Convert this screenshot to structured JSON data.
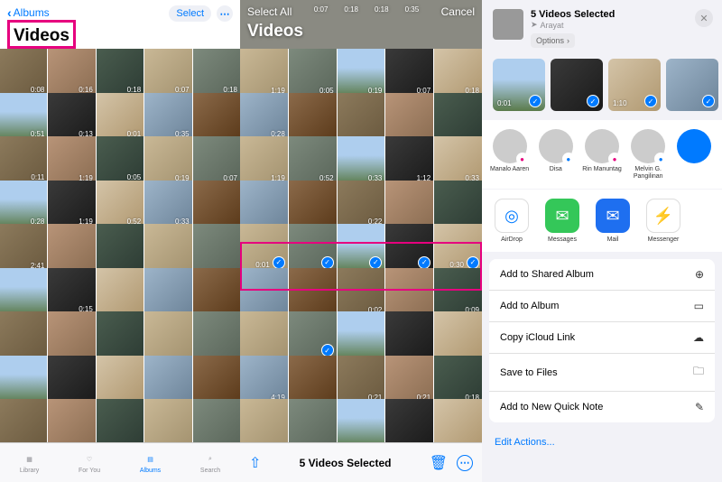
{
  "panel1": {
    "back_label": "Albums",
    "select_label": "Select",
    "title": "Videos",
    "grid_durations": [
      "0:08",
      "0:16",
      "0:18",
      "0:07",
      "0:18",
      "0:51",
      "0:13",
      "0:01",
      "0:35",
      "",
      "0:11",
      "1:19",
      "0:05",
      "0:19",
      "0:07",
      "0:28",
      "1:19",
      "0:52",
      "0:33",
      "",
      "2:41",
      "",
      "",
      "",
      "",
      "",
      "0:15",
      "",
      "",
      "",
      "",
      "",
      "",
      "",
      ""
    ],
    "tabs": {
      "library": "Library",
      "foryou": "For You",
      "albums": "Albums",
      "search": "Search"
    }
  },
  "panel2": {
    "select_all": "Select All",
    "cancel": "Cancel",
    "title": "Videos",
    "header_durations": [
      "0:07",
      "0:18",
      "0:18",
      "0:35"
    ],
    "grid_durations": [
      "1:19",
      "0:05",
      "0:19",
      "0:07",
      "0:18",
      "0:28",
      "",
      "",
      "",
      "",
      "1:19",
      "0:52",
      "0:33",
      "1:12",
      "0:33",
      "",
      "",
      "0:22",
      "",
      "",
      "0:01",
      "",
      "",
      "",
      "0:30",
      "",
      "",
      "0:02",
      "",
      "0:09",
      "",
      "",
      "",
      "",
      "",
      "4:19",
      "",
      "0:21",
      "0:21",
      "0:18",
      "",
      "",
      "",
      "",
      ""
    ],
    "selected_indices": [
      20,
      21,
      22,
      23,
      24,
      31
    ],
    "highlight_row_start": 20,
    "toolbar": {
      "selected_text": "5 Videos Selected"
    }
  },
  "panel3": {
    "title": "5 Videos Selected",
    "location": "Arayat",
    "options_label": "Options",
    "thumbs": [
      {
        "dur": "0:01"
      },
      {
        "dur": ""
      },
      {
        "dur": "1:10"
      },
      {
        "dur": ""
      }
    ],
    "contacts": [
      {
        "name": "Manalo Aaren",
        "badge_color": "#e6007e"
      },
      {
        "name": "Disa",
        "badge_color": "#007aff"
      },
      {
        "name": "Rin Manuntag",
        "badge_color": "#e6007e"
      },
      {
        "name": "Melvin G. Pangilinan",
        "badge_color": "#007aff"
      }
    ],
    "apps": [
      {
        "name": "AirDrop",
        "bg": "#ffffff",
        "fg": "#007aff",
        "glyph": "◎"
      },
      {
        "name": "Messages",
        "bg": "#34c759",
        "glyph": "✉"
      },
      {
        "name": "Mail",
        "bg": "#1e6ff0",
        "glyph": "✉"
      },
      {
        "name": "Messenger",
        "bg": "#ffffff",
        "fg": "#a033ff",
        "glyph": "⚡"
      }
    ],
    "actions": [
      {
        "label": "Add to Shared Album",
        "icon": "⊕"
      },
      {
        "label": "Add to Album",
        "icon": "▭"
      },
      {
        "label": "Copy iCloud Link",
        "icon": "☁"
      },
      {
        "label": "Save to Files",
        "icon": "🗀"
      },
      {
        "label": "Add to New Quick Note",
        "icon": "✎"
      }
    ],
    "edit_actions": "Edit Actions..."
  },
  "thumb_classes": [
    "bg-a",
    "bg-b",
    "bg-c",
    "bg-d",
    "bg-e",
    "bg-f",
    "bg-g",
    "bg-h",
    "bg-i",
    "bg-j"
  ]
}
